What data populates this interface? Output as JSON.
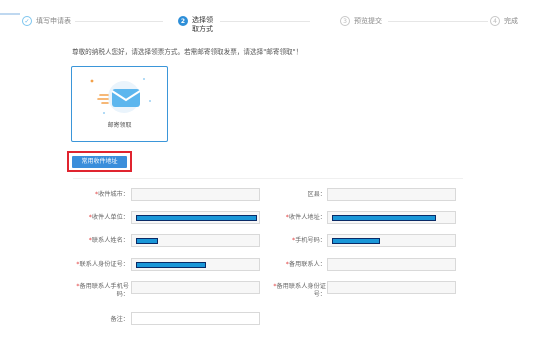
{
  "steps": [
    {
      "num": "✓",
      "label": "填写申请表"
    },
    {
      "num": "2",
      "label": "选择领取方式"
    },
    {
      "num": "3",
      "label": "预览提交"
    },
    {
      "num": "4",
      "label": "完成"
    }
  ],
  "notice": "尊敬的纳税人您好，请选择领票方式。若需邮寄领取发票，请选择\"邮寄领取\"！",
  "card": {
    "label": "邮寄领取"
  },
  "address_button": "常用收件地址",
  "form": {
    "city_label": "收件城市：",
    "district_label": "区县：",
    "unit_label": "收件人单位：",
    "address_label": "收件人地址：",
    "contact_name_label": "联系人姓名：",
    "phone_label": "手机号码：",
    "id_label": "联系人身份证号：",
    "backup_contact_label": "备用联系人：",
    "backup_phone_label_1": "备用联系人手机号",
    "backup_phone_label_2": "码：",
    "backup_id_label_1": "备用联系人身份证",
    "backup_id_label_2": "号：",
    "remark_label": "备注："
  },
  "colors": {
    "accent": "#2e8fd8",
    "highlight": "#e0242f",
    "redaction": "#1a97d8"
  }
}
